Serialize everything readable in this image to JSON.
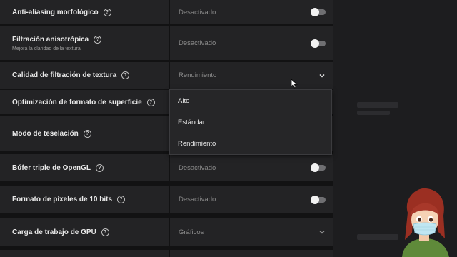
{
  "settings": [
    {
      "label": "Anti-aliasing morfológico",
      "sublabel": "",
      "value": "Desactivado",
      "control": "toggle"
    },
    {
      "label": "Filtración anisotrópica",
      "sublabel": "Mejora la claridad de la textura",
      "value": "Desactivado",
      "control": "toggle"
    },
    {
      "label": "Calidad de filtración de textura",
      "sublabel": "",
      "value": "Rendimiento",
      "control": "dropdown"
    },
    {
      "label": "Optimización de formato de superficie",
      "sublabel": "",
      "value": "",
      "control": "none"
    },
    {
      "label": "Modo de teselación",
      "sublabel": "",
      "value": "",
      "control": "none"
    },
    {
      "label": "Búfer triple de OpenGL",
      "sublabel": "",
      "value": "Desactivado",
      "control": "toggle"
    },
    {
      "label": "Formato de píxeles de 10 bits",
      "sublabel": "",
      "value": "Desactivado",
      "control": "toggle"
    },
    {
      "label": "Carga de trabajo de GPU",
      "sublabel": "",
      "value": "Gráficos",
      "control": "dropdown"
    }
  ],
  "dropdown_options": [
    "Alto",
    "Estándar",
    "Rendimiento"
  ],
  "help_glyph": "?",
  "icons": {
    "help": "question-circle-icon",
    "chevron": "chevron-down-icon",
    "cursor": "mouse-pointer-icon"
  },
  "colors": {
    "background": "#121213",
    "row": "#232325",
    "toggle_off": "#6f6f72",
    "knob": "#f2f2f2",
    "dropdown": "#262628"
  }
}
